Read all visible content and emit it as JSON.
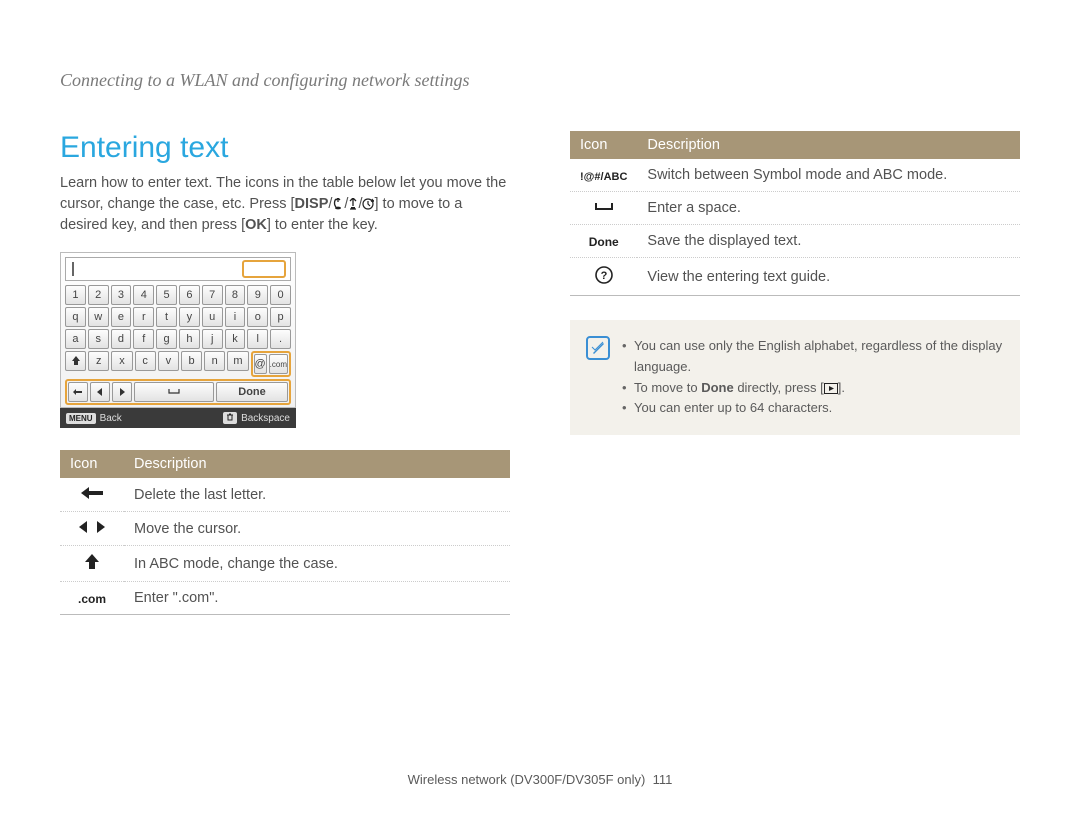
{
  "breadcrumb": "Connecting to a WLAN and configuring network settings",
  "section_title": "Entering text",
  "intro_part1": "Learn how to enter text. The icons in the table below let you move the cursor, change the case, etc. Press [",
  "intro_disp": "DISP",
  "intro_part2": "] to move to a desired key, and then press [",
  "intro_ok": "OK",
  "intro_part3": "] to enter the key.",
  "keyboard": {
    "row1": [
      "1",
      "2",
      "3",
      "4",
      "5",
      "6",
      "7",
      "8",
      "9",
      "0"
    ],
    "row2": [
      "q",
      "w",
      "e",
      "r",
      "t",
      "y",
      "u",
      "i",
      "o",
      "p"
    ],
    "row3": [
      "a",
      "s",
      "d",
      "f",
      "g",
      "h",
      "j",
      "k",
      "l",
      "."
    ],
    "row4_rest": [
      "z",
      "x",
      "c",
      "v",
      "b",
      "n",
      "m"
    ],
    "row4_at": "@",
    "row4_com": ".com",
    "done": "Done",
    "footer_menu": "MENU",
    "footer_back": "Back",
    "footer_bs": "Backspace"
  },
  "table_left": {
    "header_icon": "Icon",
    "header_desc": "Description",
    "rows": [
      {
        "icon": "arrow-left-thick",
        "desc": "Delete the last letter."
      },
      {
        "icon": "tri-left-right",
        "desc": "Move the cursor."
      },
      {
        "icon": "arrow-up-thick",
        "desc": "In ABC mode, change the case."
      },
      {
        "icon": ".com",
        "desc": "Enter \".com\"."
      }
    ]
  },
  "table_right": {
    "header_icon": "Icon",
    "header_desc": "Description",
    "rows": [
      {
        "icon": "!@#/ABC",
        "desc": "Switch between Symbol mode and ABC mode."
      },
      {
        "icon": "space-bar",
        "desc": "Enter a space."
      },
      {
        "icon": "Done",
        "desc": "Save the displayed text."
      },
      {
        "icon": "question-circle",
        "desc": "View the entering text guide."
      }
    ]
  },
  "note": {
    "items": [
      {
        "pre": "You can use only the English alphabet, regardless of the display language.",
        "bold": "",
        "post": ""
      },
      {
        "pre": "To move to ",
        "bold": "Done",
        "post": " directly, press [",
        "tail_icon": true,
        "tail": "]."
      },
      {
        "pre": "You can enter up to 64 characters.",
        "bold": "",
        "post": ""
      }
    ]
  },
  "footer": {
    "text": "Wireless network (DV300F/DV305F only)",
    "page": "111"
  }
}
